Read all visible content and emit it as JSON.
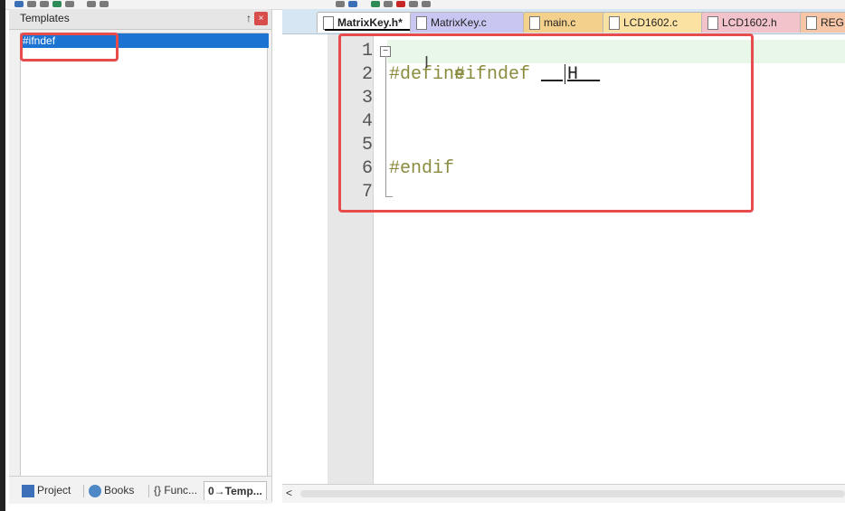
{
  "panel": {
    "title": "Templates",
    "pin_label": "↑",
    "close_label": "×",
    "items": [
      "#ifndef"
    ]
  },
  "bottom_tabs": [
    {
      "label": "Project",
      "icon": "project-icon"
    },
    {
      "label": "Books",
      "icon": "books-icon"
    },
    {
      "label": "{} Func...",
      "icon": "functions-icon"
    },
    {
      "label": "0→Temp...",
      "icon": "templates-icon",
      "active": true
    }
  ],
  "tabs": [
    {
      "label": "MatrixKey.h*",
      "active": true,
      "color": "#b7d8ee"
    },
    {
      "label": "MatrixKey.c",
      "color": "#c9c7f2"
    },
    {
      "label": "main.c",
      "color": "#f3d08b"
    },
    {
      "label": "LCD1602.c",
      "color": "#fbe2a2"
    },
    {
      "label": "LCD1602.h",
      "color": "#f3c3cc"
    },
    {
      "label": "REG",
      "color": "#f7c6a6"
    }
  ],
  "editor": {
    "line_numbers": [
      "1",
      "2",
      "3",
      "4",
      "5",
      "6",
      "7"
    ],
    "code_lines": [
      "#ifndef ",
      "#define",
      "",
      "",
      "",
      "#endif",
      ""
    ],
    "line1_placeholder_left": "__",
    "line1_placeholder_mid": "H",
    "line1_placeholder_right": "__"
  },
  "scrollbar": {
    "left_arrow": "<"
  },
  "colors": {
    "highlight": "#e74b4b",
    "selection": "#1d73d2",
    "current_line": "#e9f7e8"
  }
}
